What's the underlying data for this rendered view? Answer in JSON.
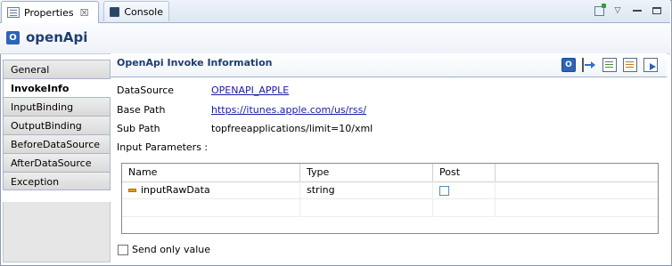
{
  "tabs": [
    {
      "label": "Properties",
      "close": "☒"
    },
    {
      "label": "Console"
    }
  ],
  "header": {
    "icon_letter": "O",
    "title": "openApi"
  },
  "sidebar": {
    "items": [
      {
        "label": "General"
      },
      {
        "label": "InvokeInfo"
      },
      {
        "label": "InputBinding"
      },
      {
        "label": "OutputBinding"
      },
      {
        "label": "BeforeDataSource"
      },
      {
        "label": "AfterDataSource"
      },
      {
        "label": "Exception"
      }
    ],
    "active": "InvokeInfo"
  },
  "section": {
    "title": "OpenApi Invoke Information",
    "toolbar_open_letter": "O"
  },
  "fields": {
    "datasource": {
      "label": "DataSource",
      "value": "OPENAPI_APPLE"
    },
    "base_path": {
      "label": "Base Path",
      "value": "https://itunes.apple.com/us/rss/"
    },
    "sub_path": {
      "label": "Sub Path",
      "value": "topfreeapplications/limit=10/xml"
    }
  },
  "params_label": "Input Parameters :",
  "table": {
    "columns": [
      "Name",
      "Type",
      "Post"
    ],
    "rows": [
      {
        "name": "inputRawData",
        "type": "string",
        "post": false
      }
    ]
  },
  "send_only": {
    "label": "Send only value",
    "checked": false
  }
}
